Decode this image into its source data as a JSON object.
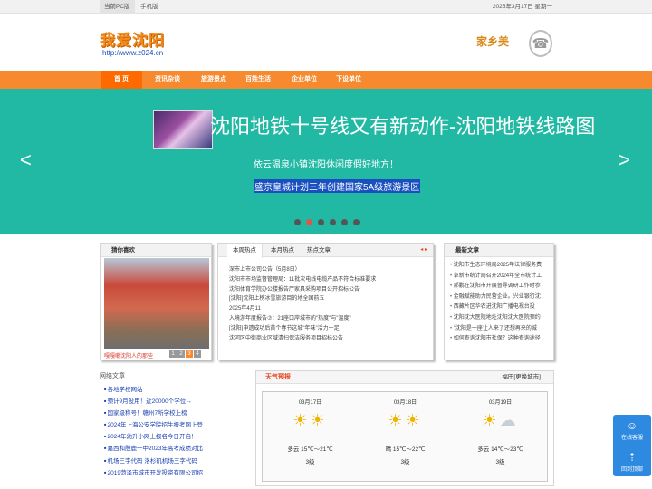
{
  "topbar": {
    "pc_label": "当前PC版",
    "mobile_label": "手机版",
    "date": "2025年3月17日 星期一"
  },
  "header": {
    "logo_text": "我爱沈阳",
    "logo_url": "http://www.z024.cn",
    "hometown": "家乡美",
    "phone_icon": "☎"
  },
  "nav": {
    "items": [
      "首 页",
      "资讯杂谈",
      "旅游景点",
      "百姓生活",
      "企业单位",
      "下设单位"
    ]
  },
  "banner": {
    "title": "沈阳地铁十号线又有新动作-沈阳地铁线路图",
    "subtitle_1": "依云温泉小镇沈阳休闲度假好地方！",
    "subtitle_2": "盛京皇城计划三年创建国家5A级旅游景区",
    "prev_arrow": "<",
    "next_arrow": ">"
  },
  "photo_box": {
    "header": "猜你喜欢",
    "caption": "嘎嘎嘞沈阳人的那些",
    "pages": [
      "1",
      "2",
      "3",
      "4"
    ]
  },
  "hot_box": {
    "tabs": [
      "本周热点",
      "本月热点",
      "热点文章"
    ],
    "arrows": "◂ ▸",
    "items": [
      "深市上市公司公告（5月8日）",
      "沈阳市市场监督管理局：11批次电线电缆产品不符合标准要求",
      "沈阳体育学院办公楼报告厅家具采购项目公开招标公告",
      "[沈阳]沈阳上榜冰雪旅游目的地全国前五",
      "2025年4月11",
      "入境游年度报告⑦：21座口岸城市的\"热度\"与\"温度\"",
      "[沈阳]申遗成功后首个春节这城\"年味\"活力十足",
      "沈河区中街商业区域清扫保洁服务项目招标公告"
    ]
  },
  "latest_box": {
    "header": "最新文章",
    "items": [
      "沈阳市生态环境局2025年法律服务费",
      "阜新市统计局召开2024年全市统计工",
      "郝鹏在沈阳市开展督导调研工作时参",
      "金融赋能助力民营企业。兴业银行沈",
      "西藏片区华农进沈阳广播电视台投",
      "沈阳沈大医院地址沈阳沈大医院预约",
      "\"沈阳是一座让人来了还想再来的城",
      "如何查询沈阳市社保？这种查询途径"
    ]
  },
  "net_articles": {
    "header": "网络文章",
    "items": [
      "各地学校网站",
      "预计9月投用！近20000个学位→",
      "国家级称号！赣州7所学校上榜",
      "2024年上海公安学院招生报考网上登",
      "2024年幼升小网上报名今日开启！",
      "嘉西和殷鹿一中2023年高考成绩对比",
      "机场三字代码 洛杉矶机场三字代码",
      "2019菏泽市城市开发投资有限公司招"
    ]
  },
  "weather": {
    "header": "天气预报",
    "city": "福田[更换城市]",
    "days": [
      {
        "date": "03月17日",
        "icon": "sun-icon",
        "temp": "多云 15℃～21℃",
        "wind": "3级"
      },
      {
        "date": "03月18日",
        "icon": "sun-icon",
        "temp": "晴 15℃～22℃",
        "wind": "3级"
      },
      {
        "date": "03月19日",
        "icon": "cloud-icon",
        "temp": "多云 14℃～23℃",
        "wind": "3级"
      }
    ]
  },
  "float_panel": {
    "online_label": "在线客服",
    "back_label": "回到顶部"
  },
  "colors": {
    "nav_orange": "#f78a2e",
    "banner_teal": "#22b9a4",
    "link_blue": "#1a3fb0",
    "weather_red": "#e8431c"
  }
}
